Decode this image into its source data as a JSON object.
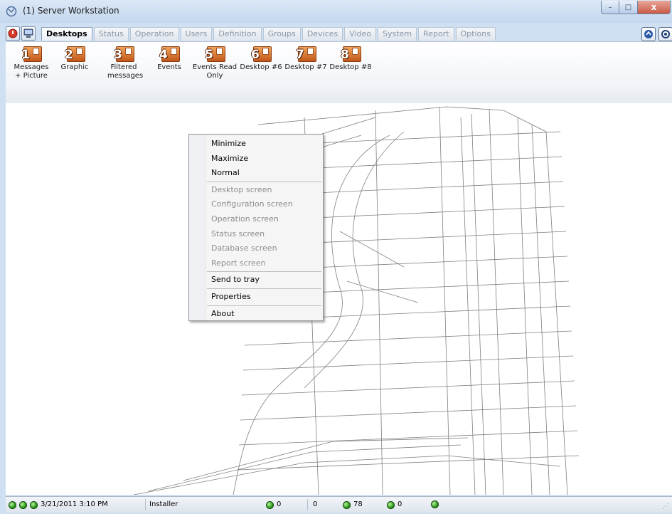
{
  "window": {
    "title": "(1) Server Workstation",
    "controls": {
      "minimize": "–",
      "maximize": "□",
      "close": "x"
    }
  },
  "tabs": [
    {
      "label": "Desktops",
      "active": true
    },
    {
      "label": "Status"
    },
    {
      "label": "Operation"
    },
    {
      "label": "Users"
    },
    {
      "label": "Definition"
    },
    {
      "label": "Groups"
    },
    {
      "label": "Devices"
    },
    {
      "label": "Video"
    },
    {
      "label": "System"
    },
    {
      "label": "Report"
    },
    {
      "label": "Options"
    }
  ],
  "ribbon": {
    "desktops": [
      {
        "num": "1",
        "label": "Messages + Picture"
      },
      {
        "num": "2",
        "label": "Graphic"
      },
      {
        "num": "3",
        "label": "Filtered messages"
      },
      {
        "num": "4",
        "label": "Events"
      },
      {
        "num": "5",
        "label": "Events Read Only"
      },
      {
        "num": "6",
        "label": "Desktop #6"
      },
      {
        "num": "7",
        "label": "Desktop #7"
      },
      {
        "num": "8",
        "label": "Desktop #8"
      }
    ]
  },
  "context_menu": {
    "items": [
      {
        "label": "Minimize",
        "enabled": true
      },
      {
        "label": "Maximize",
        "enabled": true
      },
      {
        "label": "Normal",
        "enabled": true
      },
      {
        "label": "Desktop screen",
        "enabled": false
      },
      {
        "label": "Configuration screen",
        "enabled": false
      },
      {
        "label": "Operation screen",
        "enabled": false
      },
      {
        "label": "Status screen",
        "enabled": false
      },
      {
        "label": "Database screen",
        "enabled": false
      },
      {
        "label": "Report screen",
        "enabled": false
      },
      {
        "label": "Send to tray",
        "enabled": true
      },
      {
        "label": "Properties",
        "enabled": true
      },
      {
        "label": "About",
        "enabled": true
      }
    ]
  },
  "statusbar": {
    "datetime": "3/21/2011 3:10 PM",
    "user": "Installer",
    "counter1": "0",
    "counter2": "0",
    "counter3": "78",
    "counter4": "0"
  },
  "colors": {
    "led_green": "#2e9a1a",
    "tab_active_text": "#000000",
    "tab_inactive_text": "#8a96a5",
    "desktop_icon": "#c1561a"
  }
}
